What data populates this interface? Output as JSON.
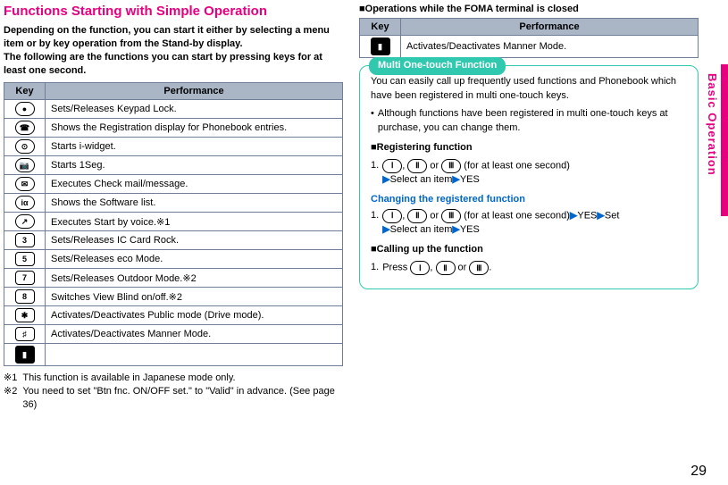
{
  "left": {
    "title": "Functions Starting with Simple Operation",
    "intro": "Depending on the function, you can start it either by selecting a menu item or by key operation from the Stand-by display.\nThe following are the functions you can start by pressing keys for at least one second.",
    "table": {
      "head_key": "Key",
      "head_perf": "Performance",
      "rows": [
        {
          "icon": "●",
          "perf": "Sets/Releases Keypad Lock."
        },
        {
          "icon": "☎",
          "perf": "Shows the Registration display for Phonebook entries."
        },
        {
          "icon": "⊙",
          "perf": "Starts i-widget."
        },
        {
          "icon": "📷",
          "perf": "Starts 1Seg."
        },
        {
          "icon": "✉",
          "perf": "Executes Check mail/message."
        },
        {
          "icon": "iα",
          "perf": "Shows the Software list."
        },
        {
          "icon": "↗",
          "perf": "Executes Start by voice.※1"
        },
        {
          "icon": "3",
          "perf": "Sets/Releases IC Card Rock."
        },
        {
          "icon": "5",
          "perf": "Sets/Releases eco Mode."
        },
        {
          "icon": "7",
          "perf": "Sets/Releases Outdoor Mode.※2"
        },
        {
          "icon": "8",
          "perf": "Switches View Blind on/off.※2"
        },
        {
          "icon": "✱",
          "perf": "Activates/Deactivates Public mode (Drive mode)."
        },
        {
          "icon": "♯",
          "perf": "Activates/Deactivates Manner Mode."
        },
        {
          "icon": "▮",
          "perf": ""
        }
      ]
    },
    "notes": [
      {
        "ref": "※1",
        "txt": "This function is available in Japanese mode only."
      },
      {
        "ref": "※2",
        "txt": "You need to set \"Btn fnc. ON/OFF set.\" to \"Valid\" in advance. (See page 36)"
      }
    ]
  },
  "right": {
    "closed_head": "■Operations while the FOMA terminal is closed",
    "table": {
      "head_key": "Key",
      "head_perf": "Performance",
      "rows": [
        {
          "icon": "▮",
          "perf": "Activates/Deactivates Manner Mode."
        }
      ]
    },
    "callout": {
      "tab": "Multi One-touch Function",
      "body": "You can easily call up frequently used functions and Phonebook which have been registered in multi one-touch keys.",
      "bullet": "Although functions have been registered in multi one-touch keys at purchase, you can change them.",
      "reg_head": "■Registering function",
      "reg_step_prefix": "1.",
      "reg_step_keys": [
        "Ⅰ",
        "Ⅱ",
        "Ⅲ"
      ],
      "reg_step_tail": " (for at least one second)",
      "reg_step_l2a": "Select an item",
      "reg_step_l2b": "YES",
      "change_head": "Changing the registered function",
      "change_step_prefix": "1.",
      "change_step_tail": " (for at least one second)",
      "change_yes": "YES",
      "change_set": "Set",
      "change_l2a": "Select an item",
      "change_l2b": "YES",
      "call_head": "■Calling up the function",
      "call_step_prefix": "1.",
      "call_press": "Press ",
      "call_period": "."
    }
  },
  "side_label": "Basic Operation",
  "page_number": "29",
  "misc": {
    "comma": ", ",
    "or": " or "
  }
}
